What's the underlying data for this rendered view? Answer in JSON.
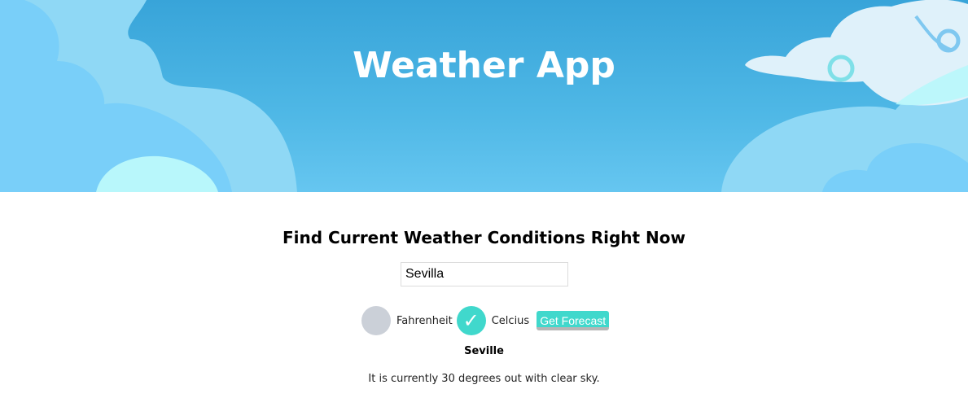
{
  "header": {
    "title": "Weather App"
  },
  "main": {
    "subtitle": "Find Current Weather Conditions Right Now",
    "search": {
      "value": "Sevilla",
      "placeholder": ""
    },
    "units": [
      {
        "label": "Fahrenheit",
        "selected": false
      },
      {
        "label": "Celcius",
        "selected": true
      }
    ],
    "check_glyph": "✓",
    "forecast_button": "Get Forecast",
    "result": {
      "city": "Seville",
      "description": "It is currently 30 degrees out with clear sky."
    }
  },
  "colors": {
    "sky": "#38a4d9",
    "accent": "#40d8cc",
    "unselected": "#cbd0d8"
  }
}
